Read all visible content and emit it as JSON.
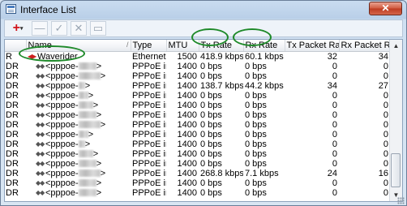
{
  "window": {
    "title": "Interface List",
    "close_glyph": "✕",
    "icons": [
      "app-icon",
      "close-icon"
    ]
  },
  "toolbar": {
    "add_glyph": "+",
    "add_arrow": "▾",
    "buttons": [
      {
        "name": "remove-button",
        "glyph": "—"
      },
      {
        "name": "enable-button",
        "glyph": "✓"
      },
      {
        "name": "disable-button",
        "glyph": "✕"
      },
      {
        "name": "comment-button",
        "glyph": "▭"
      }
    ]
  },
  "table": {
    "columns": [
      "",
      "Name",
      "Type",
      "MTU",
      "Tx Rate",
      "Rx Rate",
      "Tx Packet Rate",
      "Rx Packet Rate"
    ],
    "sort_indicator": "/",
    "rows": [
      {
        "flag": "R",
        "name": "Waverider",
        "type": "Ethernet",
        "mtu": "1500",
        "tx": "418.9 kbps",
        "rx": "60.1 kbps",
        "txp": "32",
        "rxp": "34"
      },
      {
        "flag": "DR",
        "name": "<pppoe-",
        "name_end": ">",
        "type": "PPPoE in",
        "mtu": "1400",
        "tx": "0 bps",
        "rx": "0 bps",
        "txp": "0",
        "rxp": "0"
      },
      {
        "flag": "DR",
        "name": "<pppoe-",
        "name_end": ">",
        "type": "PPPoE in",
        "mtu": "1400",
        "tx": "0 bps",
        "rx": "0 bps",
        "txp": "0",
        "rxp": "0"
      },
      {
        "flag": "DR",
        "name": "<pppoe-",
        "name_end": ">",
        "type": "PPPoE in",
        "mtu": "1400",
        "tx": "138.7 kbps",
        "rx": "44.2 kbps",
        "txp": "34",
        "rxp": "27"
      },
      {
        "flag": "DR",
        "name": "<pppoe-",
        "name_end": ">",
        "type": "PPPoE in",
        "mtu": "1400",
        "tx": "0 bps",
        "rx": "0 bps",
        "txp": "0",
        "rxp": "0"
      },
      {
        "flag": "DR",
        "name": "<pppoe-",
        "name_end": ">",
        "type": "PPPoE in",
        "mtu": "1400",
        "tx": "0 bps",
        "rx": "0 bps",
        "txp": "0",
        "rxp": "0"
      },
      {
        "flag": "DR",
        "name": "<pppoe-",
        "name_end": ">",
        "type": "PPPoE in",
        "mtu": "1400",
        "tx": "0 bps",
        "rx": "0 bps",
        "txp": "0",
        "rxp": "0"
      },
      {
        "flag": "DR",
        "name": "<pppoe-",
        "name_end": ">",
        "type": "PPPoE in",
        "mtu": "1400",
        "tx": "0 bps",
        "rx": "0 bps",
        "txp": "0",
        "rxp": "0"
      },
      {
        "flag": "DR",
        "name": "<pppoe-",
        "name_end": ">",
        "type": "PPPoE in",
        "mtu": "1400",
        "tx": "0 bps",
        "rx": "0 bps",
        "txp": "0",
        "rxp": "0"
      },
      {
        "flag": "DR",
        "name": "<pppoe-",
        "name_end": ">",
        "type": "PPPoE in",
        "mtu": "1400",
        "tx": "0 bps",
        "rx": "0 bps",
        "txp": "0",
        "rxp": "0"
      },
      {
        "flag": "DR",
        "name": "<pppoe-",
        "name_end": ">",
        "type": "PPPoE in",
        "mtu": "1400",
        "tx": "0 bps",
        "rx": "0 bps",
        "txp": "0",
        "rxp": "0"
      },
      {
        "flag": "DR",
        "name": "<pppoe-",
        "name_end": ">",
        "type": "PPPoE in",
        "mtu": "1400",
        "tx": "0 bps",
        "rx": "0 bps",
        "txp": "0",
        "rxp": "0"
      },
      {
        "flag": "DR",
        "name": "<pppoe-",
        "name_end": ">",
        "type": "PPPoE in",
        "mtu": "1400",
        "tx": "268.8 kbps",
        "rx": "7.1 kbps",
        "txp": "24",
        "rxp": "16"
      },
      {
        "flag": "DR",
        "name": "<pppoe-",
        "name_end": ">",
        "type": "PPPoE in",
        "mtu": "1400",
        "tx": "0 bps",
        "rx": "0 bps",
        "txp": "0",
        "rxp": "0"
      },
      {
        "flag": "DR",
        "name": "<pppoe-",
        "name_end": ">",
        "type": "PPPoE in",
        "mtu": "1400",
        "tx": "0 bps",
        "rx": "0 bps",
        "txp": "0",
        "rxp": "0"
      }
    ]
  },
  "annotation": {
    "color": "#1f8a2a"
  }
}
